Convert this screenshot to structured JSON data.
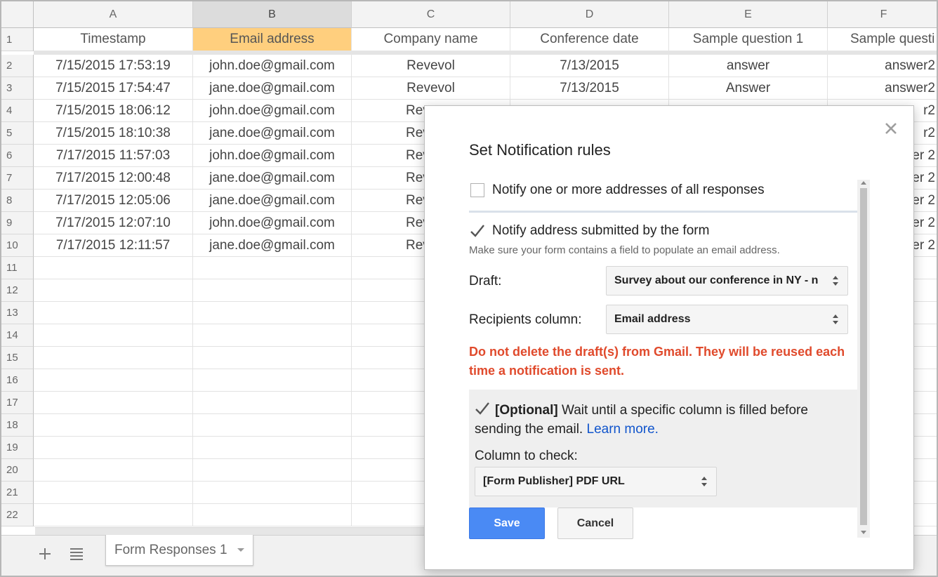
{
  "sheet": {
    "columns": [
      "A",
      "B",
      "C",
      "D",
      "E",
      "F"
    ],
    "row_numbers": [
      "1",
      "2",
      "3",
      "4",
      "5",
      "6",
      "7",
      "8",
      "9",
      "10",
      "11",
      "12",
      "13",
      "14",
      "15",
      "16",
      "17",
      "18",
      "19",
      "20",
      "21",
      "22"
    ],
    "headers": [
      "Timestamp",
      "Email address",
      "Company name",
      "Conference date",
      "Sample question 1",
      "Sample questi"
    ],
    "rows": [
      [
        "7/15/2015 17:53:19",
        "john.doe@gmail.com",
        "Revevol",
        "7/13/2015",
        "answer",
        "answer2"
      ],
      [
        "7/15/2015 17:54:47",
        "jane.doe@gmail.com",
        "Revevol",
        "7/13/2015",
        "Answer",
        "answer2"
      ],
      [
        "7/15/2015 18:06:12",
        "john.doe@gmail.com",
        "Rev",
        "",
        "",
        "r2"
      ],
      [
        "7/15/2015 18:10:38",
        "jane.doe@gmail.com",
        "Rev",
        "",
        "",
        "r2"
      ],
      [
        "7/17/2015 11:57:03",
        "john.doe@gmail.com",
        "Rev",
        "",
        "",
        "er 2"
      ],
      [
        "7/17/2015 12:00:48",
        "jane.doe@gmail.com",
        "Rev",
        "",
        "",
        "er 2"
      ],
      [
        "7/17/2015 12:05:06",
        "jane.doe@gmail.com",
        "Rev",
        "",
        "",
        "er 2"
      ],
      [
        "7/17/2015 12:07:10",
        "john.doe@gmail.com",
        "Rev",
        "",
        "",
        "er 2"
      ],
      [
        "7/17/2015 12:11:57",
        "jane.doe@gmail.com",
        "Rev",
        "",
        "",
        "er 2"
      ]
    ],
    "selected_column": "B",
    "tab_label": "Form Responses 1",
    "add_sheet_icon": "plus-icon",
    "all_sheets_icon": "list-icon",
    "highlight_color": "#ffcf7e"
  },
  "dialog": {
    "title": "Set Notification rules",
    "close_icon": "close-icon",
    "option_all_responses": "Notify one or more addresses of all responses",
    "option_all_responses_checked": false,
    "option_submitted": "Notify address submitted by the form",
    "option_submitted_checked": true,
    "hint": "Make sure your form contains a field to populate an email address.",
    "draft_label": "Draft:",
    "draft_value": "Survey about our conference in NY - n",
    "recipients_label": "Recipients column:",
    "recipients_value": "Email address",
    "warning": "Do not delete the draft(s) from Gmail. They will be reused each time a notification is sent.",
    "optional_tag": "[Optional]",
    "optional_text": " Wait until a specific column is filled before sending the email. ",
    "learn_more": "Learn more.",
    "optional_checked": true,
    "column_check_label": "Column to check:",
    "column_check_value": "[Form Publisher] PDF URL",
    "save_label": "Save",
    "cancel_label": "Cancel",
    "warning_color": "#e04a2c",
    "save_color": "#4a8af4",
    "focus_border_color": "#f0842d"
  }
}
